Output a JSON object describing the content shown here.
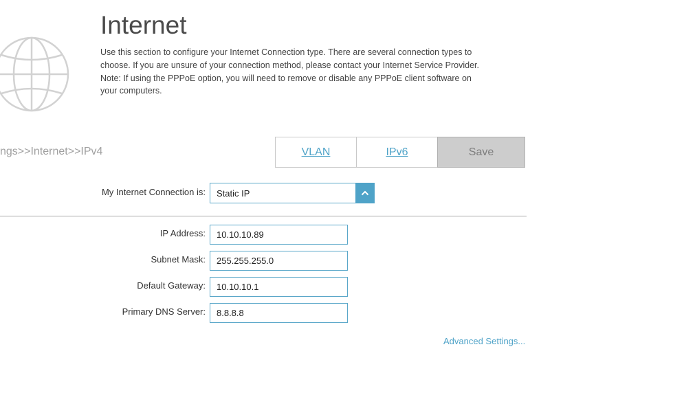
{
  "page": {
    "title": "Internet",
    "description": [
      "Use this section to configure your Internet Connection type. There are several connection types to",
      "choose. If you are unsure of your connection method, please contact your Internet Service Provider.",
      "Note: If using the PPPoE option, you will need to remove or disable any PPPoE client software on",
      "your computers."
    ],
    "icon": "globe-icon"
  },
  "breadcrumb": "ngs>>Internet>>IPv4",
  "tabs": {
    "vlan": "VLAN",
    "ipv6": "IPv6",
    "save": "Save"
  },
  "connection": {
    "label": "My Internet Connection is:",
    "value": "Static IP",
    "arrow_icon": "chevron-up-icon"
  },
  "fields": {
    "ip_address": {
      "label": "IP Address:",
      "value": "10.10.10.89"
    },
    "subnet_mask": {
      "label": "Subnet Mask:",
      "value": "255.255.255.0"
    },
    "default_gateway": {
      "label": "Default Gateway:",
      "value": "10.10.10.1"
    },
    "primary_dns": {
      "label": "Primary DNS Server:",
      "value": "8.8.8.8"
    }
  },
  "advanced_link": "Advanced Settings...",
  "colors": {
    "accent": "#4fa3c8",
    "title": "#4a4a4a",
    "save_bg": "#cdcdcd",
    "breadcrumb": "#a0a0a0"
  }
}
